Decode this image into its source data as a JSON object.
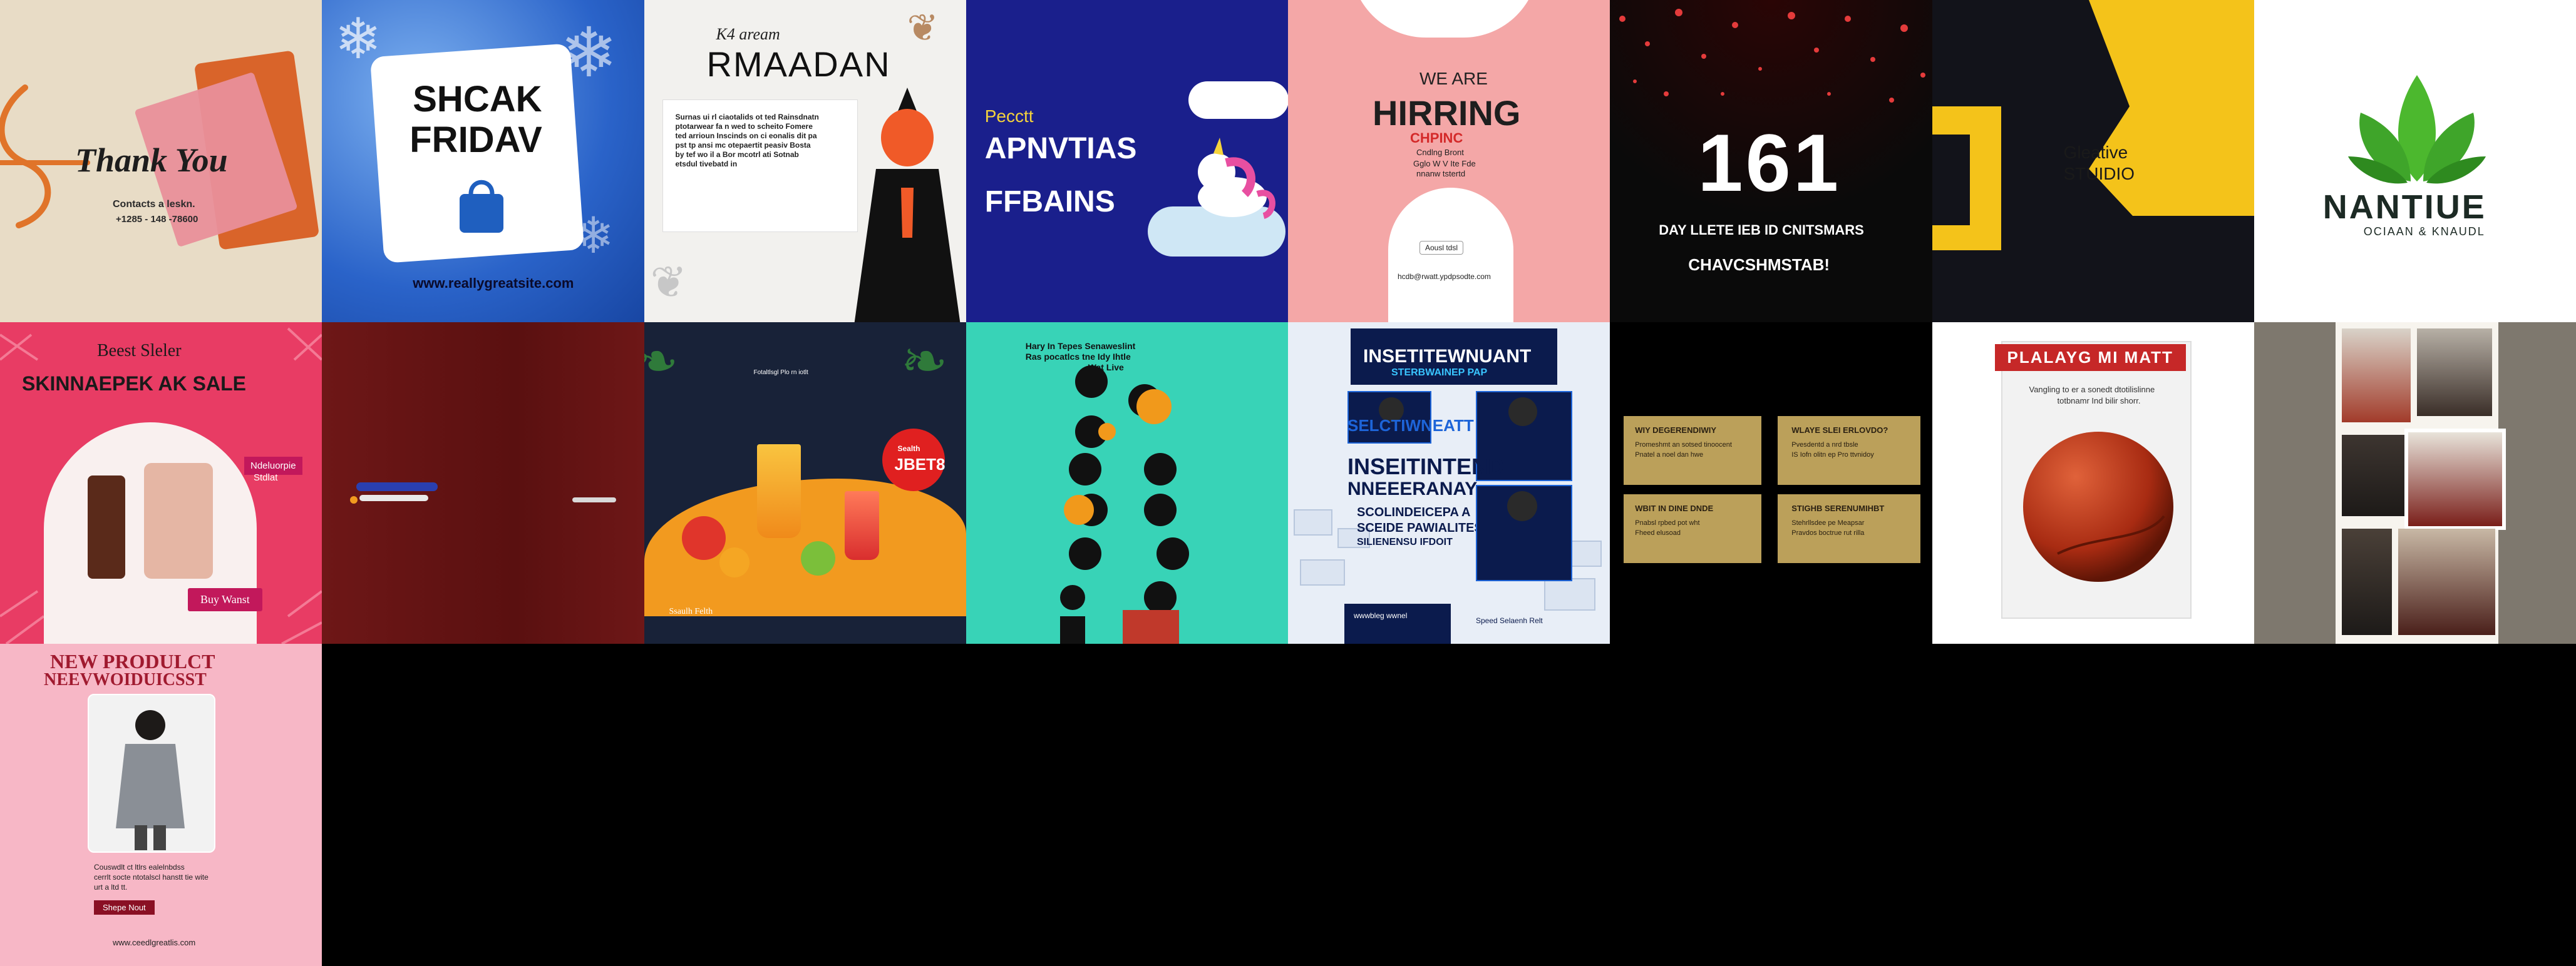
{
  "tiles": {
    "thank_you": {
      "title": "Thank You",
      "line1": "Contacts a leskn.",
      "line2": "+1285 - 148 -78600",
      "colors": {
        "bg": "#e8dcc6",
        "orange": "#e0742a",
        "pink": "#e98f9a"
      }
    },
    "black_friday": {
      "line1": "SHCAK",
      "line2": "FRIDAV",
      "url": "www.reallygreatsite.com",
      "colors": {
        "bg": "#3c78d8",
        "panel": "#ffffff",
        "bag": "#1f5fbf"
      }
    },
    "ramadan": {
      "small": "K4 aream",
      "title": "RMAADAN",
      "body": "Surnas ui rl ciaotalids ot ted Rainsdnatn ptotarwear fa n wed to scheito Fomere ted arrioun Inscinds on ci eonalis dit pa pst tp ansi mc otepaertit peasiv Bosta by tef wo il a Bor mcotrl ati Sotnab etsdul tivebatd in",
      "colors": {
        "bg": "#f2f1ee",
        "skin": "#f05a28",
        "cloth": "#111111"
      }
    },
    "animals": {
      "small": "Pecctt",
      "line1": "APNVTIAS",
      "line2": "FFBAINS",
      "colors": {
        "bg": "#1a1f8c",
        "yellow": "#f5d33c"
      }
    },
    "hiring": {
      "line1": "WE ARE",
      "line2": "HIRRING",
      "line3": "CHPINC",
      "line4": "Cndlng Bront",
      "line5": "Gglo W V Ite Fde",
      "line6": "nnanw tstertd",
      "button": "Aousl tdsl",
      "url": "hcdb@rwatt.ypdpsodte.com",
      "colors": {
        "bg": "#f4a7a7",
        "white": "#ffffff",
        "red": "#d42a2a"
      }
    },
    "countdown": {
      "number": "161",
      "line1": "DAY LLETE IEB ID CNITSMARS",
      "line2": "CHAVCSHMSTAB!",
      "colors": {
        "bg": "#0a0a0a",
        "dot": "#e43b3b"
      }
    },
    "studio": {
      "line1": "Gleative",
      "line2": "STUIDIO",
      "colors": {
        "bg": "#12131a",
        "yellow": "#f4c31a"
      }
    },
    "nature": {
      "title": "NANTIUE",
      "subtitle": "OCIAAN & KNAUDL",
      "colors": {
        "bg": "#ffffff",
        "green": "#4cb82e",
        "dark": "#1c2a24"
      }
    },
    "skincare": {
      "small": "Beest Sleler",
      "title": "SKINNAEPEK AK SALE",
      "tag1": "Ndeluorpie",
      "tag2": "Stdlat",
      "button": "Buy Wanst",
      "colors": {
        "bg": "#e83c64",
        "arch": "#f9f0ef",
        "tag": "#c2185b"
      }
    },
    "maroon": {
      "colors": {
        "bg": "#6e1717",
        "accent": "#2a3fb0"
      }
    },
    "juice": {
      "small": "Fotaltlsgl Plo rn iotlt",
      "badge": "Sealth",
      "badge_sub": "JBET8",
      "footer": "Ssaulh Felth",
      "colors": {
        "bg": "#182238",
        "orange": "#f29a1f",
        "red": "#e02020"
      }
    },
    "teal_list": {
      "heading_l1": "Hary In Tepes Senaweslint",
      "heading_l2": "Ras pocatlcs tne Idy Ihtle",
      "heading_l3": "Wat Live",
      "colors": {
        "bg": "#38d3b7",
        "dark": "#111111",
        "orange": "#f1991b"
      }
    },
    "webinar": {
      "heading1": "INSETITEWNUANT",
      "heading2": "STERBWAINEP PAP",
      "label": "SELCTIWNEATT",
      "big1": "INSEITINTEND",
      "big2": "NNEEERANAY",
      "sub1": "SCOLINDEICEPA A",
      "sub2": "SCEIDE PAWIALITES",
      "sub3": "SILIENENSU IFDOIT",
      "foot": "wwwbleg wwnel",
      "foot2": "Speed Selaenh Relt",
      "colors": {
        "bg": "#e8eef7",
        "navy": "#0b1b4d",
        "blue": "#1d64d8"
      }
    },
    "cards": {
      "c1_title": "WIY DEGERENDIWIY",
      "c1_l1": "Promeshmt an sotsed tinoocent",
      "c1_l2": "Pnatel a noel dan hwe",
      "c2_title": "WLAYE SLEI ERLOVDO?",
      "c2_l1": "Pvesdentd a nrd tbsle",
      "c2_l2": "IS Iofn olitn ep Pro ttvnidoy",
      "c3_title": "WBIT IN DINE DNDE",
      "c3_l1": "Pnabsl rpbed pot wht",
      "c3_l2": "Fheed elusoad",
      "c4_title": "STIGHB SERENUMIHBT",
      "c4_l1": "Stehrllsdee pe Meapsar",
      "c4_l2": "Pravdos boctrue rut rilla",
      "colors": {
        "bg": "#000000",
        "card": "#bba05a"
      }
    },
    "playing": {
      "banner": "PLALAYG MI MATT",
      "line1": "Vangling to er a sonedt dtotilislinne",
      "line2": "totbnamr Ind bilir shorr.",
      "colors": {
        "bg": "#ffffff",
        "frame": "#f2f2f2",
        "banner": "#c62828",
        "ball": "#a82b12"
      }
    },
    "collage": {
      "colors": {
        "bg": "#7e786e"
      }
    },
    "new_product": {
      "title1": "NEW PRODULCT",
      "title2": "NEEVWOIDUICSST",
      "line1": "Couswdlt ct ltlrs ealelnbdss",
      "line2": "cerrlt socte ntotalscl hanstt tie wite",
      "line3": "urt a ltd tt.",
      "button": "Shepe Nout",
      "url": "www.ceedlgreatlis.com",
      "colors": {
        "bg": "#f7b7c6",
        "photo": "#f2f2f2",
        "title": "#a01a2f"
      }
    }
  }
}
